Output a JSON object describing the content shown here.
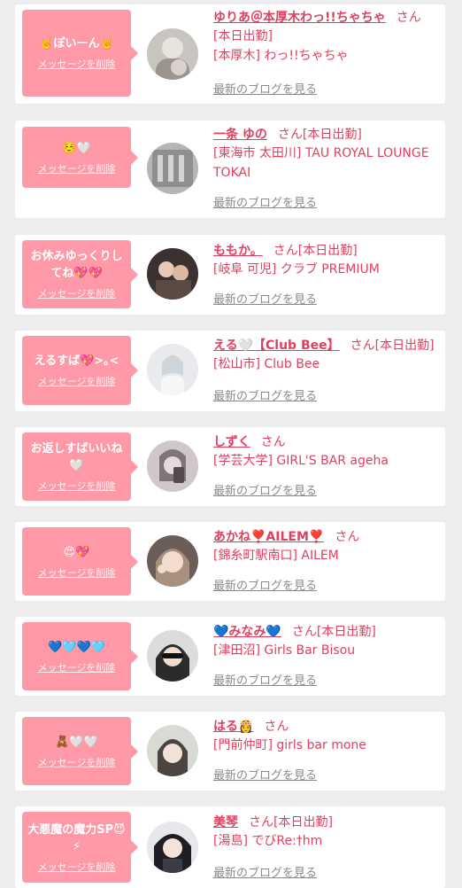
{
  "colors": {
    "accent": "#e0405f",
    "bubble": "#ff99a8",
    "link_gray": "#8a8a8a",
    "background": "#ededed"
  },
  "common": {
    "delete_label": "メッセージを削除",
    "blog_label": "最新のブログを見る",
    "san": "さん"
  },
  "items": [
    {
      "message": "🤘ぽいーん🤘",
      "name": "ゆりあ＠本厚木わっ!!ちゃちゃ",
      "suffix": "さん",
      "line2": "[本日出勤]",
      "line3": "[本厚木] わっ!!ちゃちゃ"
    },
    {
      "message": "☺️🤍",
      "name": "一条 ゆの",
      "suffix": "さん[本日出勤]",
      "line2": "[東海市 太田川] TAU ROYAL LOUNGE TOKAI",
      "line3": ""
    },
    {
      "message": "お休みゆっくりしてね💖💖",
      "name": "ももか。",
      "suffix": "さん[本日出勤]",
      "line2": "[岐阜 可児] クラブ PREMIUM",
      "line3": ""
    },
    {
      "message": "えるすば💖>｡<",
      "name": "える🤍【Club Bee】",
      "suffix": "さん[本日出勤]",
      "line2": "[松山市] Club Bee",
      "line3": ""
    },
    {
      "message": "お返しすばいいね🤍",
      "name": "しずく",
      "suffix": "さん",
      "line2": "[学芸大学] GIRL'S BAR ageha",
      "line3": ""
    },
    {
      "message": "😍💖",
      "name": "あかね❣️AILEM❣️",
      "suffix": "さん",
      "line2": "[錦糸町駅南口] AILEM",
      "line3": ""
    },
    {
      "message": "💙🩵💙🩵",
      "name": "💙みなみ💙",
      "suffix": "さん[本日出勤]",
      "line2": "[津田沼] Girls Bar Bisou",
      "line3": ""
    },
    {
      "message": "🧸🤍🤍",
      "name": "はる👸",
      "suffix": "さん",
      "line2": "[門前仲町] girls bar mone",
      "line3": ""
    },
    {
      "message": "大悪魔の魔力SP😈⚡",
      "name": "美琴",
      "suffix": "さん[本日出勤]",
      "line2": "[湯島] でびRe:†hm",
      "line3": ""
    }
  ]
}
